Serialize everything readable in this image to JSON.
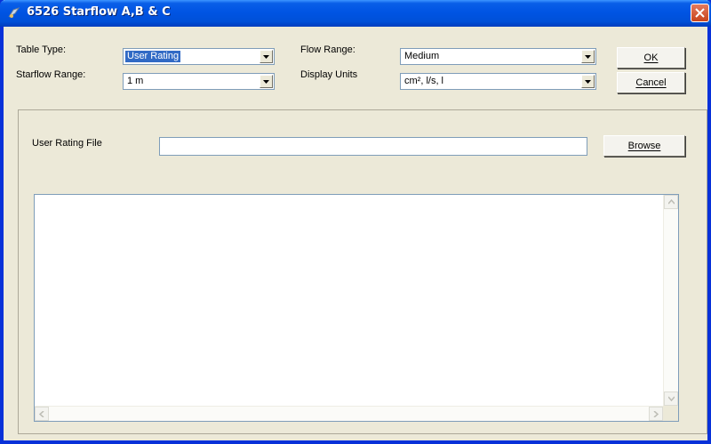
{
  "window": {
    "title": "6526 Starflow A,B & C"
  },
  "form": {
    "table_type_label": "Table Type:",
    "table_type_value": "User Rating",
    "starflow_range_label": "Starflow Range:",
    "starflow_range_value": "1 m",
    "flow_range_label": "Flow Range:",
    "flow_range_value": "Medium",
    "display_units_label": "Display Units",
    "display_units_value": "cm², l/s, l"
  },
  "buttons": {
    "ok_label": "OK",
    "cancel_label": "Cancel",
    "browse_label": "Browse"
  },
  "rating_file": {
    "label": "User Rating File",
    "value": ""
  },
  "icons": {
    "app": "starflow-app-icon",
    "close": "close-icon",
    "dropdown": "chevron-down-icon",
    "scroll_up": "scroll-up-icon",
    "scroll_down": "scroll-down-icon",
    "scroll_left": "scroll-left-icon",
    "scroll_right": "scroll-right-icon"
  },
  "colors": {
    "titlebar": "#0054e3",
    "face": "#ece9d8",
    "selection": "#316ac5",
    "close": "#c8441c"
  }
}
